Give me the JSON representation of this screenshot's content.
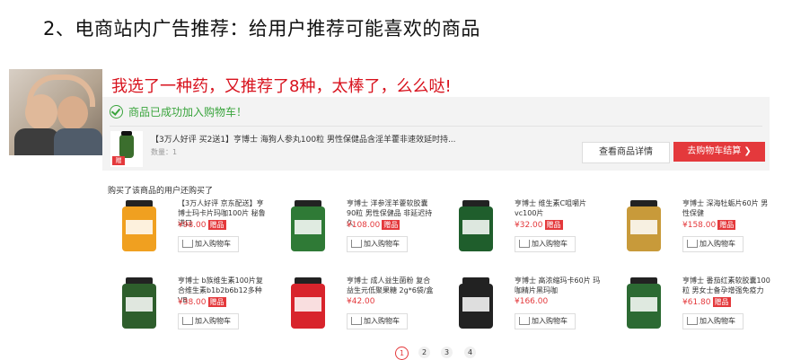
{
  "heading": "2、电商站内广告推荐：给用户推荐可能喜欢的商品",
  "caption": "我选了一种药，又推荐了8种，太棒了，么么哒!",
  "cart_panel": {
    "success_text": "商品已成功加入购物车！",
    "product_name": "【3万人好评 买2送1】亨博士 海狗人参丸100粒 男性保健品含淫羊藿非速效延时持...",
    "quantity_text": "数量：1",
    "detail_button": "查看商品详情",
    "checkout_button": "去购物车结算 ❯",
    "gift_badge": "赠"
  },
  "recommend_title": "购买了该商品的用户还购买了",
  "add_label": "加入购物车",
  "gift_tag": "赠品",
  "products": [
    {
      "name": "【3万人好评 京东配送】亨博士玛卡片玛咖100片 秘鲁进口",
      "price": "¥98.00",
      "gift": true,
      "color": "#f0a020"
    },
    {
      "name": "亨博士 洋参淫羊藿软胶囊90粒 男性保健品 非延迟持久",
      "price": "¥108.00",
      "gift": true,
      "color": "#2f7a36"
    },
    {
      "name": "亨博士 维生素C咀嚼片vc100片",
      "price": "¥32.00",
      "gift": true,
      "color": "#1f5e2c"
    },
    {
      "name": "亨博士 深海牡蛎片60片 男性保健",
      "price": "¥158.00",
      "gift": true,
      "color": "#c89a3a"
    },
    {
      "name": "亨博士 b族维生素100片复合维生素b1b2b6b12多种VB",
      "price": "¥38.00",
      "gift": true,
      "color": "#2e5e2c"
    },
    {
      "name": "亨博士 成人益生菌粉 复合益生元低聚果糖 2g*6袋/盒",
      "price": "¥42.00",
      "gift": false,
      "color": "#d8242c"
    },
    {
      "name": "亨博士 高浓缩玛卡60片 玛咖精片黑玛咖",
      "price": "¥166.00",
      "gift": false,
      "color": "#222222"
    },
    {
      "name": "亨博士 番茄红素软胶囊100粒 男女士备孕增强免疫力",
      "price": "¥61.80",
      "gift": true,
      "color": "#2c6a33"
    }
  ],
  "pages": [
    "1",
    "2",
    "3",
    "4"
  ],
  "colors": {
    "accent": "#e4393c",
    "success": "#39a43c",
    "caption": "#d8121d"
  }
}
